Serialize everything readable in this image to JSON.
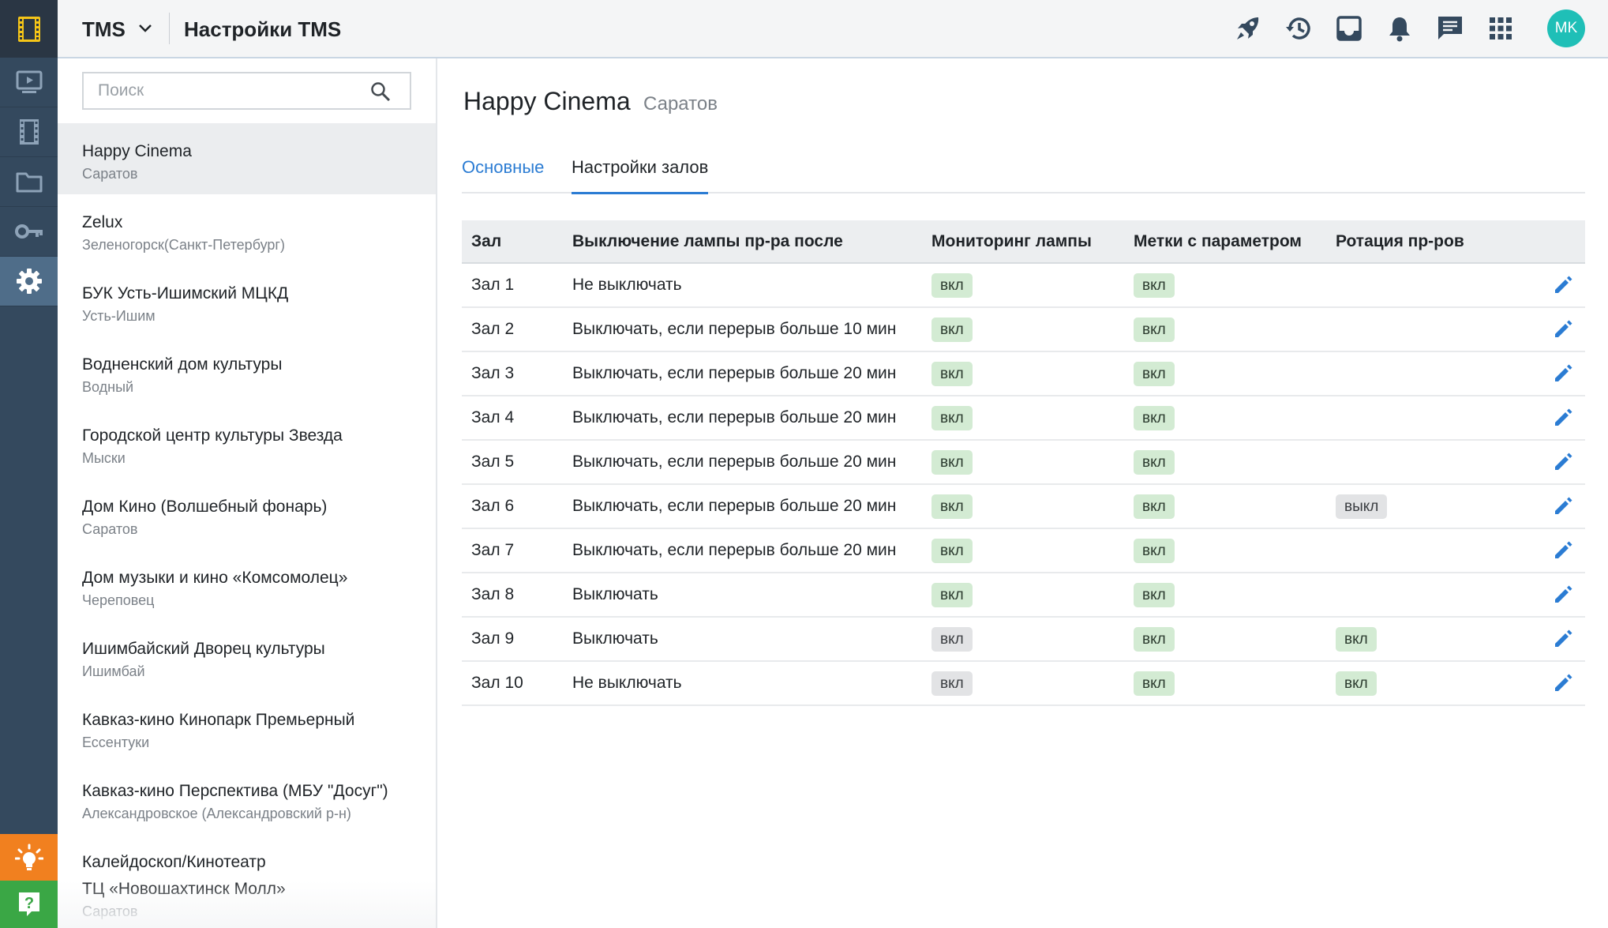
{
  "colors": {
    "accent": "#2b7cd3",
    "rail": "#34495e",
    "avatar": "#1fbfb7",
    "badge_on": "#d3ebd3",
    "badge_off": "#e2e3e5",
    "help": "#3aa745",
    "ideas": "#f1801f"
  },
  "rail": {
    "logo_icon": "film-logo-icon",
    "items": [
      {
        "icon": "player-icon"
      },
      {
        "icon": "film-strip-icon"
      },
      {
        "icon": "folder-icon"
      },
      {
        "icon": "key-icon"
      },
      {
        "icon": "gear-icon",
        "active": true
      }
    ],
    "bottom": [
      {
        "icon": "lightbulb-icon"
      },
      {
        "icon": "help-icon"
      }
    ]
  },
  "header": {
    "app_name": "TMS",
    "title": "Настройки TMS",
    "icons": [
      "rocket-icon",
      "history-icon",
      "inbox-icon",
      "bell-icon",
      "chat-icon",
      "apps-grid-icon"
    ],
    "avatar_initials": "MK"
  },
  "sidebar": {
    "search_placeholder": "Поиск",
    "cinemas": [
      {
        "name": "Happy Cinema",
        "city": "Саратов",
        "active": true
      },
      {
        "name": "Zelux",
        "city": "Зеленогорск(Санкт-Петербург)"
      },
      {
        "name": "БУК Усть-Ишимский МЦКД",
        "city": "Усть-Ишим"
      },
      {
        "name": "Водненский дом культуры",
        "city": "Водный"
      },
      {
        "name": "Городской центр культуры Звезда",
        "city": "Мыски"
      },
      {
        "name": "Дом Кино (Волшебный фонарь)",
        "city": "Саратов"
      },
      {
        "name": "Дом музыки и кино «Комсомолец»",
        "city": "Череповец"
      },
      {
        "name": "Ишимбайский Дворец культуры",
        "city": "Ишимбай"
      },
      {
        "name": "Кавказ-кино Кинопарк Премьерный",
        "city": "Ессентуки"
      },
      {
        "name": "Кавказ-кино Перспектива (МБУ \"Досуг\")",
        "city": "Александровское (Александровский р-н)"
      },
      {
        "name": "Калейдоскоп/Кинотеатр\nТЦ «Новошахтинск Молл»",
        "city": "Саратов"
      }
    ]
  },
  "main": {
    "cinema_name": "Happy Cinema",
    "cinema_city": "Саратов",
    "tabs": [
      {
        "label": "Основные"
      },
      {
        "label": "Настройки залов",
        "active": true
      }
    ],
    "table": {
      "headers": [
        "Зал",
        "Выключение лампы пр-ра после",
        "Мониторинг лампы",
        "Метки с параметром",
        "Ротация пр-ров"
      ],
      "rows": [
        {
          "hall": "Зал 1",
          "lamp_off": "Не выключать",
          "monitoring": {
            "label": "вкл",
            "state": "on"
          },
          "marks": {
            "label": "вкл",
            "state": "on"
          },
          "rotation": null
        },
        {
          "hall": "Зал 2",
          "lamp_off": "Выключать, если перерыв больше 10 мин",
          "monitoring": {
            "label": "вкл",
            "state": "on"
          },
          "marks": {
            "label": "вкл",
            "state": "on"
          },
          "rotation": null
        },
        {
          "hall": "Зал 3",
          "lamp_off": "Выключать, если перерыв больше 20 мин",
          "monitoring": {
            "label": "вкл",
            "state": "on"
          },
          "marks": {
            "label": "вкл",
            "state": "on"
          },
          "rotation": null
        },
        {
          "hall": "Зал 4",
          "lamp_off": "Выключать, если перерыв больше 20 мин",
          "monitoring": {
            "label": "вкл",
            "state": "on"
          },
          "marks": {
            "label": "вкл",
            "state": "on"
          },
          "rotation": null
        },
        {
          "hall": "Зал 5",
          "lamp_off": "Выключать, если перерыв больше 20 мин",
          "monitoring": {
            "label": "вкл",
            "state": "on"
          },
          "marks": {
            "label": "вкл",
            "state": "on"
          },
          "rotation": null
        },
        {
          "hall": "Зал 6",
          "lamp_off": "Выключать, если перерыв больше 20 мин",
          "monitoring": {
            "label": "вкл",
            "state": "on"
          },
          "marks": {
            "label": "вкл",
            "state": "on"
          },
          "rotation": {
            "label": "выкл",
            "state": "off"
          }
        },
        {
          "hall": "Зал 7",
          "lamp_off": "Выключать, если перерыв больше 20 мин",
          "monitoring": {
            "label": "вкл",
            "state": "on"
          },
          "marks": {
            "label": "вкл",
            "state": "on"
          },
          "rotation": null
        },
        {
          "hall": "Зал 8",
          "lamp_off": "Выключать",
          "monitoring": {
            "label": "вкл",
            "state": "on"
          },
          "marks": {
            "label": "вкл",
            "state": "on"
          },
          "rotation": null
        },
        {
          "hall": "Зал 9",
          "lamp_off": "Выключать",
          "monitoring": {
            "label": "вкл",
            "state": "off"
          },
          "marks": {
            "label": "вкл",
            "state": "on"
          },
          "rotation": {
            "label": "вкл",
            "state": "on"
          }
        },
        {
          "hall": "Зал 10",
          "lamp_off": "Не выключать",
          "monitoring": {
            "label": "вкл",
            "state": "off"
          },
          "marks": {
            "label": "вкл",
            "state": "on"
          },
          "rotation": {
            "label": "вкл",
            "state": "on"
          }
        }
      ],
      "row_action_icon": "edit-pencil-icon"
    }
  }
}
